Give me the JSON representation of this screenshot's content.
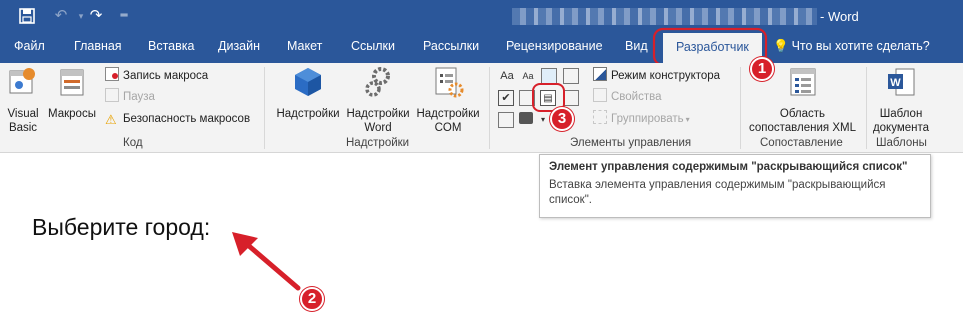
{
  "window": {
    "title": "- Word"
  },
  "tabs": [
    {
      "label": "Файл"
    },
    {
      "label": "Главная"
    },
    {
      "label": "Вставка"
    },
    {
      "label": "Дизайн"
    },
    {
      "label": "Макет"
    },
    {
      "label": "Ссылки"
    },
    {
      "label": "Рассылки"
    },
    {
      "label": "Рецензирование"
    },
    {
      "label": "Вид"
    },
    {
      "label": "Разработчик",
      "active": true
    }
  ],
  "tell_me": "Что вы хотите сделать?",
  "groups": {
    "code": {
      "label": "Код",
      "visual_basic": "Visual\nBasic",
      "macros": "Макросы",
      "record_macro": "Запись макроса",
      "pause": "Пауза",
      "macro_security": "Безопасность макросов"
    },
    "addins": {
      "label": "Надстройки",
      "addins": "Надстройки",
      "word_addins": "Надстройки\nWord",
      "com_addins": "Надстройки\nCOM"
    },
    "controls": {
      "label": "Элементы управления",
      "design_mode": "Режим конструктора",
      "properties": "Свойства",
      "group": "Группировать",
      "text_icon": "Aa"
    },
    "mapping": {
      "label": "Сопоставление",
      "xml_pane": "Область\nсопоставления XML"
    },
    "templates": {
      "label": "Шаблоны",
      "document_template": "Шаблон\nдокумента"
    }
  },
  "tooltip": {
    "title": "Элемент управления содержимым \"раскрывающийся список\"",
    "body": "Вставка элемента управления содержимым \"раскрывающийся список\"."
  },
  "document": {
    "text": "Выберите город:"
  },
  "annotations": {
    "one": "1",
    "two": "2",
    "three": "3"
  },
  "colors": {
    "accent": "#2b579a",
    "marker": "#d7202a"
  }
}
